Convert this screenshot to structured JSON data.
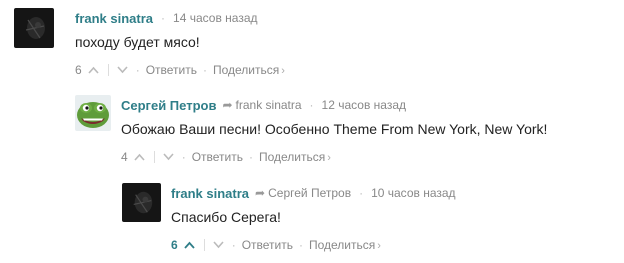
{
  "comments": [
    {
      "author": "frank sinatra",
      "reply_to": "",
      "time": "14 часов назад",
      "text": "походу будет мясо!",
      "score": "6",
      "reply_label": "Ответить",
      "share_label": "Поделиться",
      "avatar_icon": "dark-photo-avatar"
    },
    {
      "author": "Сергей Петров",
      "reply_to": "frank sinatra",
      "time": "12 часов назад",
      "text": "Обожаю Ваши песни! Особенно Theme From New York, New York!",
      "score": "4",
      "reply_label": "Ответить",
      "share_label": "Поделиться",
      "avatar_icon": "pepe-frog-avatar"
    },
    {
      "author": "frank sinatra",
      "reply_to": "Сергей Петров",
      "time": "10 часов назад",
      "text": "Спасибо Серега!",
      "score": "6",
      "reply_label": "Ответить",
      "share_label": "Поделиться",
      "avatar_icon": "dark-photo-avatar"
    }
  ],
  "colors": {
    "author": "#2f7e88",
    "muted": "#888888",
    "vote_active": "#2f7e88"
  },
  "icons": {
    "reply_arrow": "reply-arrow-icon",
    "upvote": "chevron-up-icon",
    "downvote": "chevron-down-icon",
    "share_chevron": "chevron-right-icon"
  }
}
